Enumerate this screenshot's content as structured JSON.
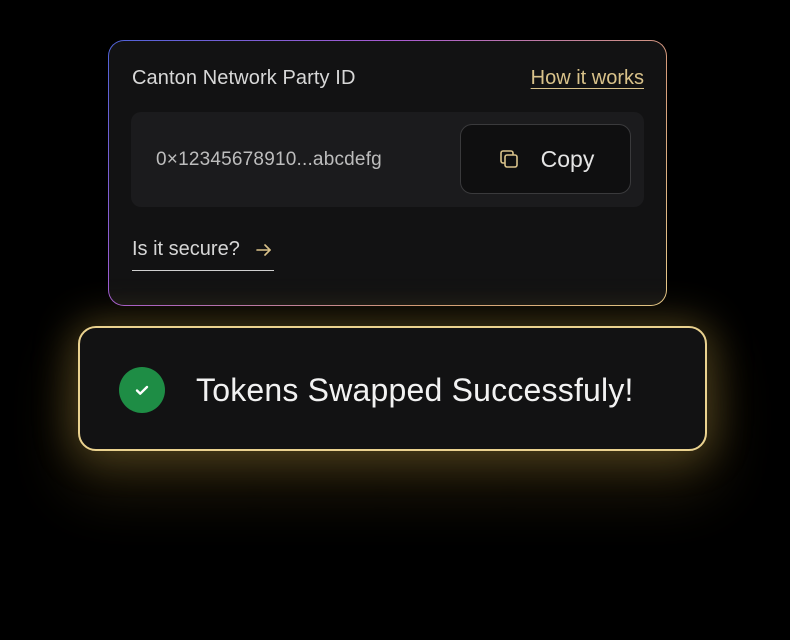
{
  "party_card": {
    "title": "Canton Network Party ID",
    "how_it_works_label": "How it works",
    "address": "0×12345678910...abcdefg",
    "copy_label": "Copy",
    "secure_label": "Is it secure?"
  },
  "toast": {
    "message": "Tokens Swapped Successfuly!",
    "status": "success"
  },
  "icons": {
    "copy": "copy-icon",
    "arrow": "arrow-right-icon",
    "check": "check-circle-icon"
  },
  "colors": {
    "background": "#000000",
    "card_background": "#121213",
    "link_gold": "#d9c28a",
    "toast_border": "#ead28f",
    "success_green": "#1e8d45"
  }
}
